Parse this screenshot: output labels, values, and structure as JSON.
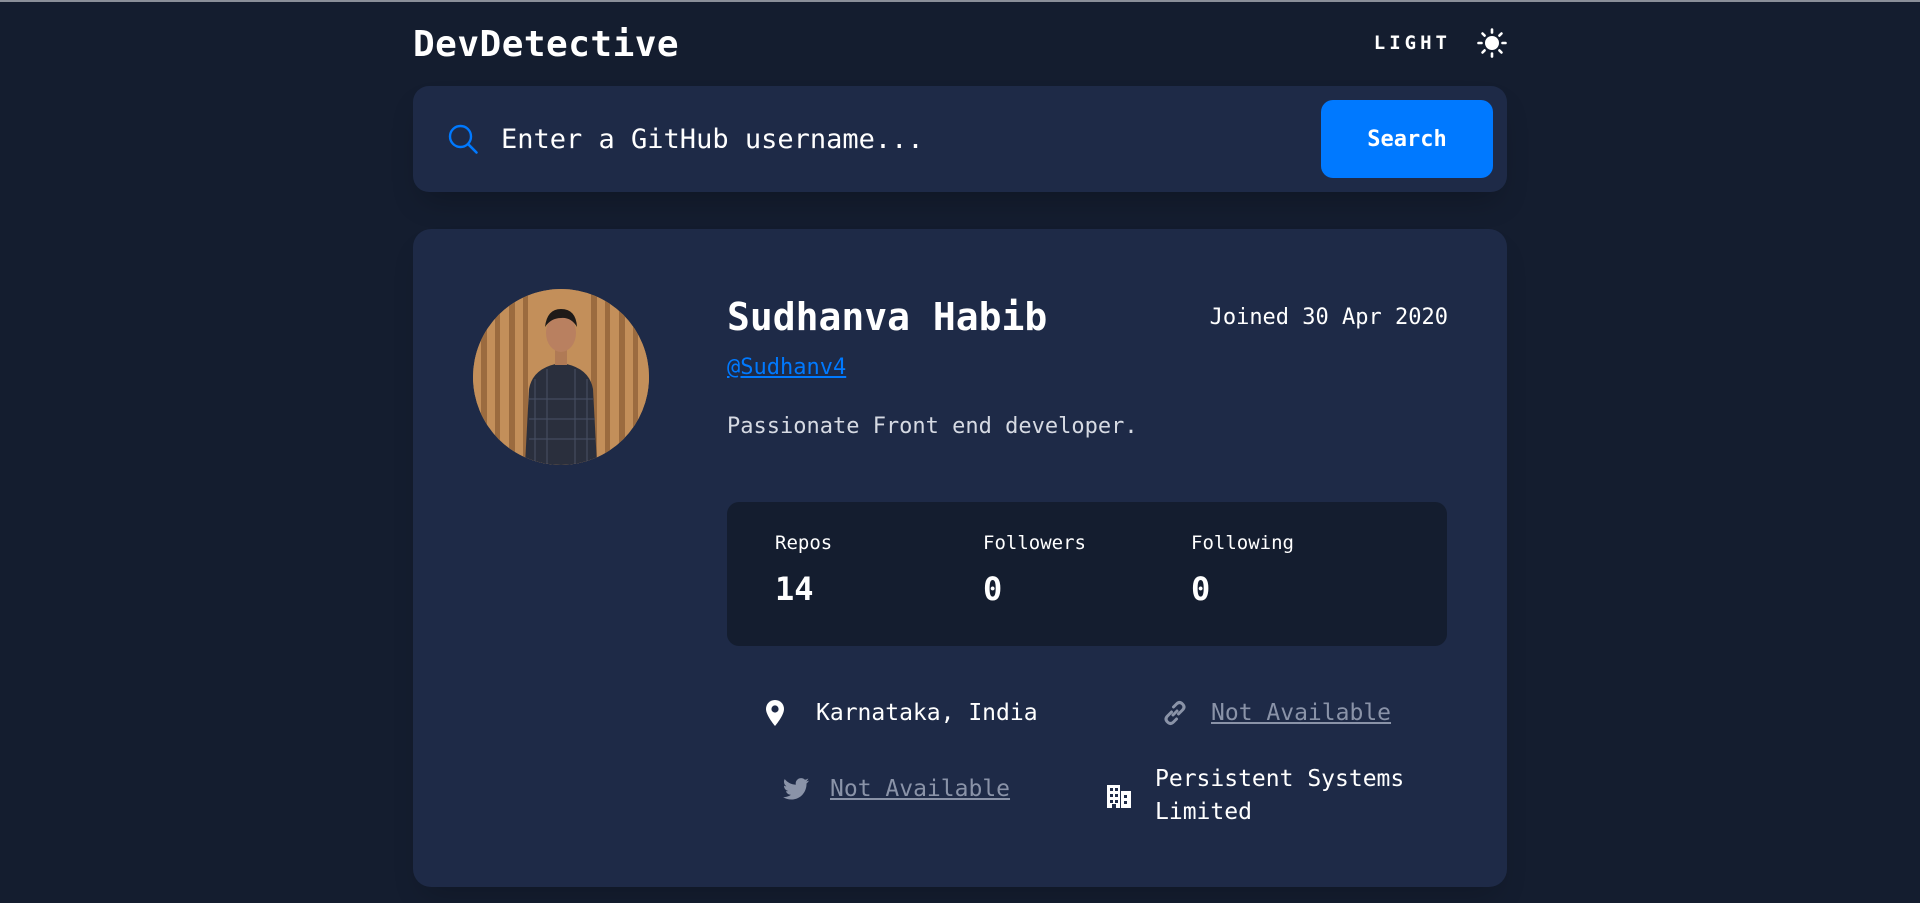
{
  "header": {
    "logo": "DevDetective",
    "mode_label": "LIGHT",
    "mode_icon": "sun-icon"
  },
  "search": {
    "placeholder": "Enter a GitHub username...",
    "value": "",
    "button_label": "Search",
    "icon": "search-icon"
  },
  "profile": {
    "name": "Sudhanva Habib",
    "joined": "Joined 30 Apr 2020",
    "login": "@Sudhanv4",
    "bio": "Passionate Front end developer.",
    "stats": [
      {
        "label": "Repos",
        "value": "14"
      },
      {
        "label": "Followers",
        "value": "0"
      },
      {
        "label": "Following",
        "value": "0"
      }
    ],
    "info": {
      "location": "Karnataka, India",
      "website": "Not Available",
      "twitter": "Not Available",
      "company": "Persistent Systems Limited"
    }
  },
  "colors": {
    "background": "#141d2f",
    "card": "#1e2a47",
    "accent": "#0079ff",
    "muted_link": "#8a93a8",
    "text": "#ffffff"
  }
}
